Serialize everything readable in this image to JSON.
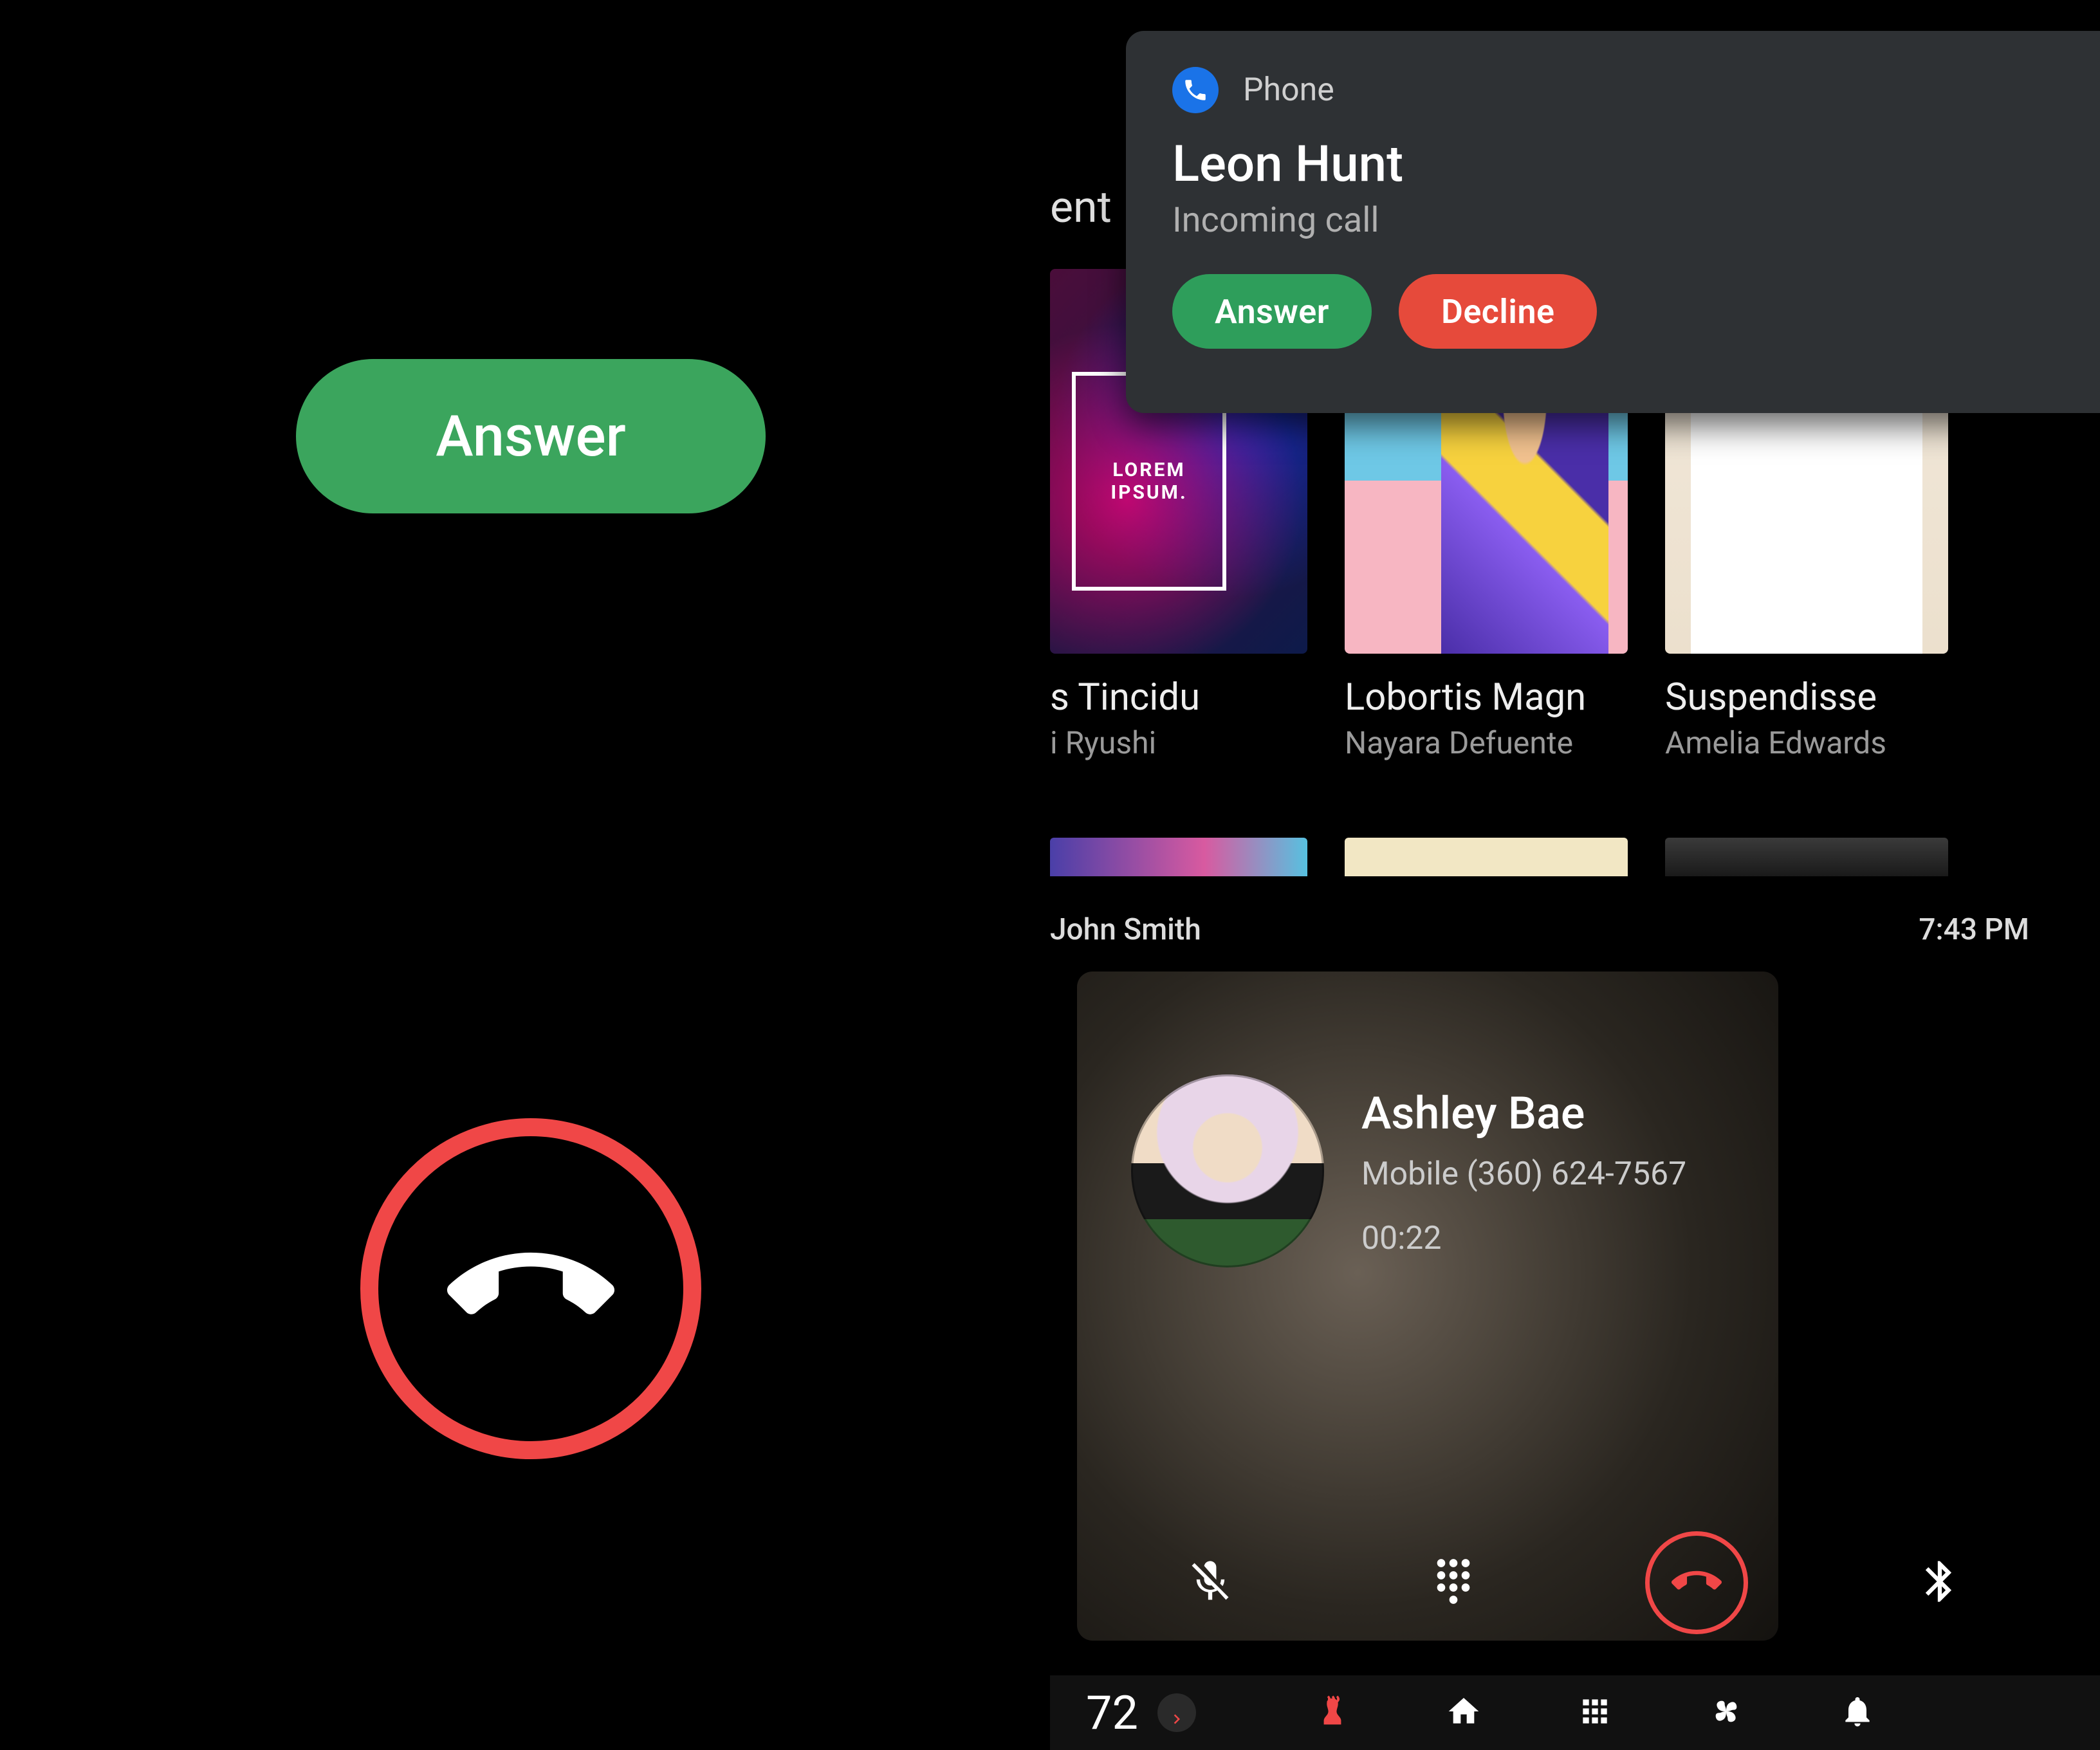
{
  "left": {
    "answer_label": "Answer"
  },
  "notification": {
    "app_name": "Phone",
    "caller": "Leon Hunt",
    "subtitle": "Incoming call",
    "answer_label": "Answer",
    "decline_label": "Decline"
  },
  "background_fragments": {
    "ent": "ent"
  },
  "media_cards": [
    {
      "title_fragment": "s Tincidu",
      "subtitle_fragment": "i Ryushi",
      "art_text": "LOREM\nIPSUM."
    },
    {
      "title": "Lobortis Magn",
      "subtitle": "Nayara Defuente"
    },
    {
      "title": "Suspendisse",
      "subtitle": "Amelia Edwards"
    }
  ],
  "status": {
    "name": "John Smith",
    "time": "7:43 PM"
  },
  "active_call": {
    "name": "Ashley Bae",
    "number_line": "Mobile (360) 624-7567",
    "duration": "00:22"
  },
  "controls": {
    "mute": "mute",
    "dialpad": "dialpad",
    "end_call": "end-call",
    "bluetooth": "bluetooth"
  },
  "sysbar": {
    "temperature": "72"
  },
  "colors": {
    "answer_green": "#3ba55d",
    "notif_green": "#2e9e5b",
    "decline_red": "#e64a3b",
    "end_red": "#f04747",
    "phone_blue": "#1a73e8"
  }
}
